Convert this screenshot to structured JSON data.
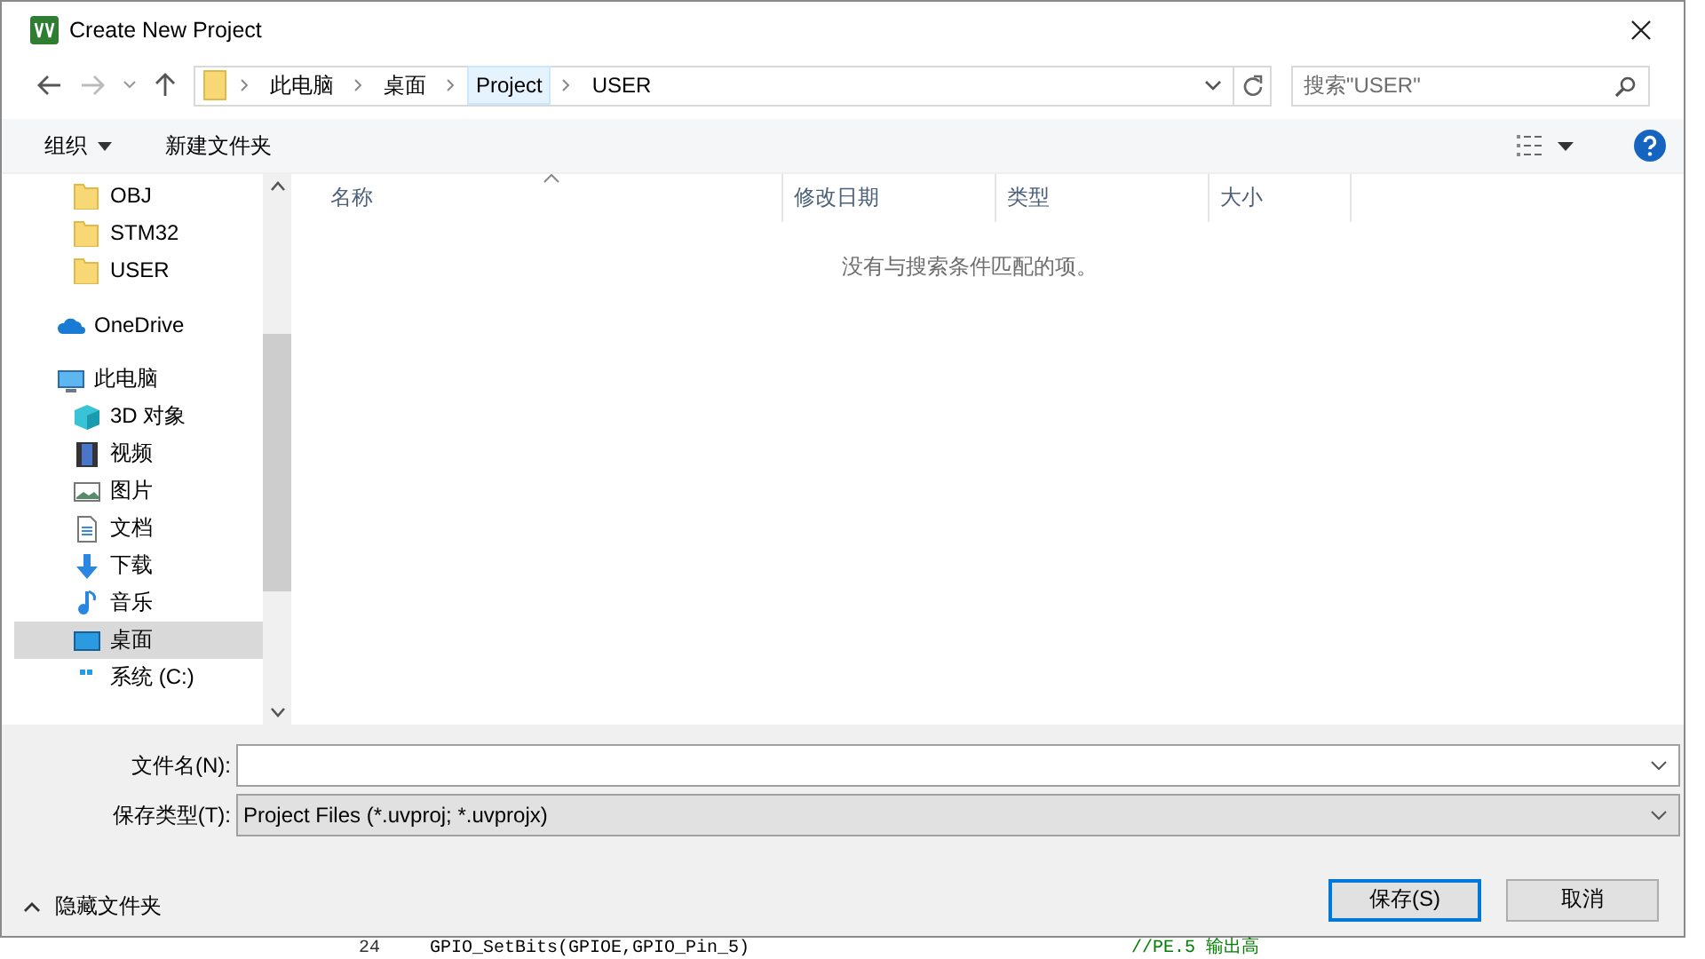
{
  "window": {
    "title": "Create New Project"
  },
  "address_bar": {
    "segments": [
      {
        "label": "此电脑",
        "selected": false
      },
      {
        "label": "桌面",
        "selected": false
      },
      {
        "label": "Project",
        "selected": true
      },
      {
        "label": "USER",
        "selected": false
      }
    ]
  },
  "search": {
    "placeholder": "搜索\"USER\""
  },
  "toolbar": {
    "organize": "组织",
    "new_folder": "新建文件夹"
  },
  "sidebar": {
    "folders": [
      {
        "label": "OBJ",
        "kind": "folder",
        "selected": false
      },
      {
        "label": "STM32",
        "kind": "folder",
        "selected": false
      },
      {
        "label": "USER",
        "kind": "folder",
        "selected": false
      }
    ],
    "items": [
      {
        "label": "OneDrive",
        "kind": "cloud",
        "selected": false
      },
      {
        "label": "此电脑",
        "kind": "computer",
        "selected": false,
        "children": [
          {
            "label": "3D 对象",
            "kind": "cube",
            "selected": false
          },
          {
            "label": "视频",
            "kind": "video",
            "selected": false
          },
          {
            "label": "图片",
            "kind": "picture",
            "selected": false
          },
          {
            "label": "文档",
            "kind": "document",
            "selected": false
          },
          {
            "label": "下载",
            "kind": "download",
            "selected": false
          },
          {
            "label": "音乐",
            "kind": "music",
            "selected": false
          },
          {
            "label": "桌面",
            "kind": "desktop",
            "selected": true
          },
          {
            "label": "系统 (C:)",
            "kind": "drive",
            "selected": false
          }
        ]
      }
    ]
  },
  "file_list": {
    "columns": [
      "名称",
      "修改日期",
      "类型",
      "大小"
    ],
    "empty_message": "没有与搜索条件匹配的项。"
  },
  "form": {
    "file_name": {
      "label": "文件名(N):"
    },
    "save_type": {
      "label": "保存类型(T):",
      "value": "Project Files (*.uvproj; *.uvprojx)"
    }
  },
  "hide_folders": "隐藏文件夹",
  "buttons": [
    {
      "label": "保存(S)",
      "default": true
    },
    {
      "label": "取消",
      "default": false
    }
  ],
  "background_editor": {
    "line_number": "24",
    "code": "GPIO_SetBits(GPIOE,GPIO_Pin_5)",
    "comment": "//PE.5 输出高"
  }
}
